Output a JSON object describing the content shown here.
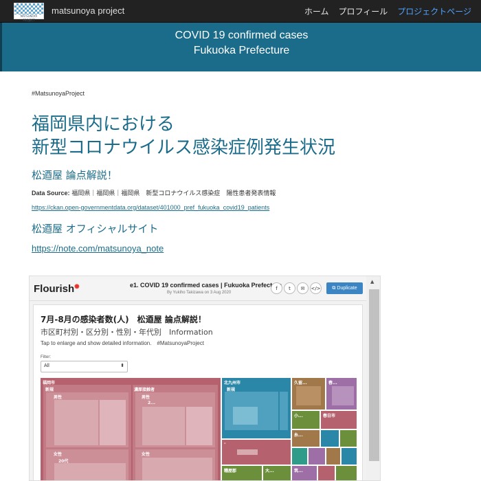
{
  "nav": {
    "brand": "matsunoya project",
    "logo_caption": "MATSUNOYA PROJECT",
    "links": [
      {
        "label": "ホーム",
        "active": false
      },
      {
        "label": "プロフィール",
        "active": false
      },
      {
        "label": "プロジェクトページ",
        "active": true
      }
    ]
  },
  "banner": {
    "line1": "COVID 19 confirmed cases",
    "line2": "Fukuoka Prefecture"
  },
  "main": {
    "hashtag": "#MatsunoyaProject",
    "title_line1": "福岡県内における",
    "title_line2": "新型コロナウイルス感染症例発生状況",
    "subtitle1": "松逎屋 論点解説！",
    "source_label": "Data Source:",
    "source_text": "福岡県｜福岡県｜福岡県　新型コロナウイルス感染症　陽性患者発表情報",
    "source_url": "https://ckan.open-governmentdata.org/dataset/401000_pref_fukuoka_covid19_patients",
    "subtitle2": "松逎屋 オフィシャルサイト",
    "note_url": "https://note.com/matsunoya_note"
  },
  "embed": {
    "logo": "Flourish",
    "title": "e1. COVID 19 confirmed cases | Fukuoka Prefecture",
    "byline": "By Yukiho Takizawa on 3 Aug 2020",
    "share_icons": [
      "facebook-icon",
      "twitter-icon",
      "email-icon",
      "code-icon"
    ],
    "share_glyphs": [
      "f",
      "t",
      "✉",
      "</>"
    ],
    "duplicate_label": "Duplicate",
    "viz_title": "7月-8月の感染者数(人)　松逎屋 論点解説！",
    "viz_subtitle": "市区町村別・区分別・性別・年代別　Information",
    "viz_desc": "Tap to enlarge and show detailed information.　#MatsunoyaProject",
    "filter_label": "Filter:",
    "filter_value": "All",
    "treemap_labels": {
      "fukuoka": "福岡市",
      "new1": "新規",
      "male1": "男性",
      "contact": "濃厚接触者",
      "male2": "男性",
      "female1": "女性",
      "age20": "20代",
      "female2": "女性",
      "kitakyushu": "北九州市",
      "new2": "新規",
      "kurume": "久留...",
      "kasuya": "糟屋郡",
      "ono": "大...",
      "other1": "春...",
      "kasuga": "春日市",
      "other2": "小...",
      "other3": "糸...",
      "other4": "筑...",
      "two": "2...",
      "dash": "-"
    },
    "colors": {
      "fukuoka": "#b5626e",
      "kitakyushu": "#2a87a8",
      "kurume": "#a0784a",
      "purple": "#9d6fa6",
      "green": "#6c8f3b",
      "teal": "#2f9c8a"
    }
  }
}
